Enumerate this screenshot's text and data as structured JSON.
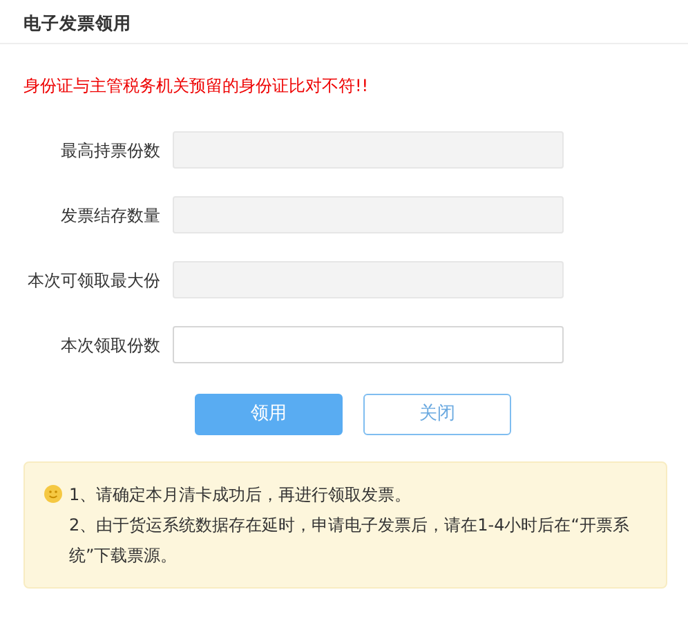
{
  "title": "电子发票领用",
  "error": "身份证与主管税务机关预留的身份证比对不符!!",
  "fields": [
    {
      "label": "最高持票份数",
      "kind": "readonly"
    },
    {
      "label": "发票结存数量",
      "kind": "readonly"
    },
    {
      "label": "本次可领取最大份",
      "kind": "readonly"
    },
    {
      "label": "本次领取份数",
      "kind": "entry"
    }
  ],
  "buttons": [
    {
      "label": "领用",
      "kind": "primary"
    },
    {
      "label": "关闭",
      "kind": "outline"
    }
  ],
  "notice": [
    "1、请确定本月清卡成功后，再进行领取发票。",
    "2、由于货运系统数据存在延时，申请电子发票后，请在1-4小时后在“开票系统”下载票源。"
  ]
}
